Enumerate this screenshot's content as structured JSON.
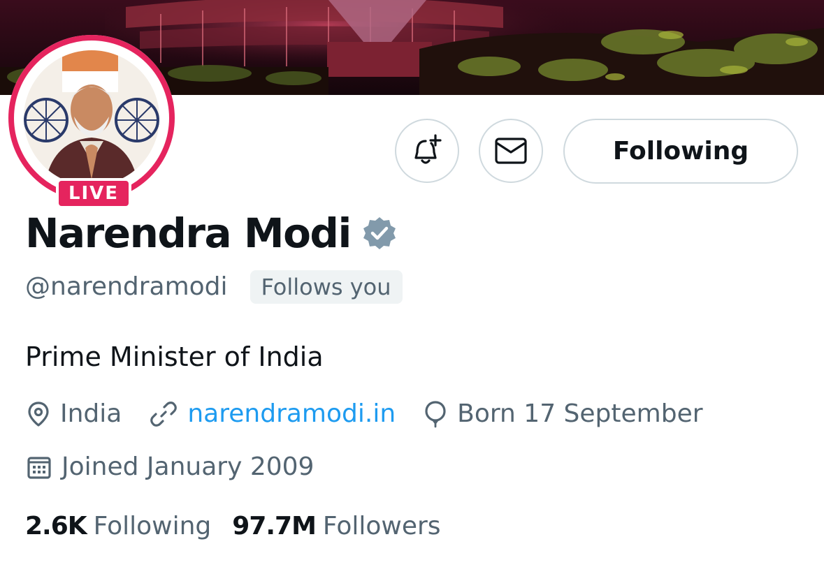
{
  "profile": {
    "display_name": "Narendra Modi",
    "handle": "@narendramodi",
    "follows_you": "Follows you",
    "live_badge": "LIVE",
    "bio": "Prime Minister of India",
    "location": "India",
    "website": "narendramodi.in",
    "birthday": "Born 17 September",
    "joined": "Joined January 2009"
  },
  "actions": {
    "following_label": "Following"
  },
  "stats": {
    "following_count": "2.6K",
    "following_label": "Following",
    "followers_count": "97.7M",
    "followers_label": "Followers"
  },
  "icons": {
    "notify": "bell-plus-icon",
    "message": "envelope-icon",
    "verified": "verified-badge-icon",
    "location": "location-pin-icon",
    "link": "link-icon",
    "birthday": "balloon-icon",
    "joined": "calendar-icon"
  },
  "colors": {
    "live_accent": "#e5245e",
    "link": "#1d9bf0",
    "secondary_text": "#536471",
    "primary_text": "#0f1419",
    "verified_gray": "#829aab",
    "border": "#cfd9de"
  }
}
